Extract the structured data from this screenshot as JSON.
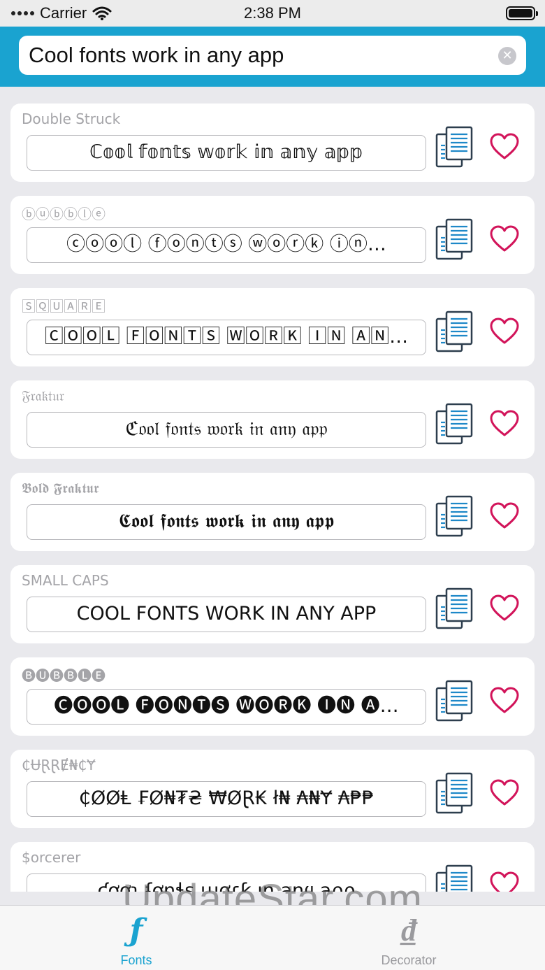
{
  "status_bar": {
    "carrier": "Carrier",
    "time": "2:38 PM"
  },
  "search": {
    "value": "Cool fonts work in any app",
    "clear_icon": "clear-circle-icon"
  },
  "cards": [
    {
      "label": "Double Struck",
      "value": "ℂ𝕠𝕠𝕝 𝕗𝕠𝕟𝕥𝕤 𝕨𝕠𝕣𝕜 𝕚𝕟 𝕒𝕟𝕪 𝕒𝕡𝕡"
    },
    {
      "label": "ⓑⓤⓑⓑⓛⓔ",
      "value": "ⓒⓞⓞⓛ ⓕⓞⓝⓣⓢ ⓦⓞⓡⓚ ⓘⓝ…"
    },
    {
      "label": "🅂🅀🅄🄰🅁🄴",
      "value": "🄲🄾🄾🄻 🄵🄾🄽🅃🅂 🅆🄾🅁🄺 🄸🄽 🄰🄽…"
    },
    {
      "label": "𝔉𝔯𝔞𝔨𝔱𝔲𝔯",
      "value": "ℭ𝔬𝔬𝔩 𝔣𝔬𝔫𝔱𝔰 𝔴𝔬𝔯𝔨 𝔦𝔫 𝔞𝔫𝔶 𝔞𝔭𝔭"
    },
    {
      "label": "𝕭𝖔𝖑𝖉 𝕱𝖗𝖆𝖐𝖙𝖚𝖗",
      "value": "𝕮𝖔𝖔𝖑 𝖋𝖔𝖓𝖙𝖘 𝖜𝖔𝖗𝖐 𝖎𝖓 𝖆𝖓𝖞 𝖆𝖕𝖕"
    },
    {
      "label": "SMALL CAPS",
      "value": "COOL FONTS WORK IN ANY APP"
    },
    {
      "label": "🅑🅤🅑🅑🅛🅔",
      "value": "🅒🅞🅞🅛 🅕🅞🅝🅣🅢 🅦🅞🅡🅚 🅘🅝 🅐…"
    },
    {
      "label": "₵ɄⱤⱤɆ₦₵Ɏ",
      "value": "₵ØØⱠ ₣Ø₦₮₴ ₩ØⱤ₭ ł₦ ₳₦Ɏ ₳₱₱"
    },
    {
      "label": "$orcerer",
      "value": "ƈơơʅ ʄơŋɬʂ ɯơɾƙ ıŋ ąŋყ ąρρ"
    }
  ],
  "tabs": [
    {
      "label": "Fonts",
      "icon": "ƒ",
      "active": true
    },
    {
      "label": "Decorator",
      "icon": "₫",
      "active": false
    }
  ],
  "watermark": "UpdateStar.com",
  "colors": {
    "header": "#1aa3d0",
    "heart": "#d2145a",
    "copy_icon": "#1e88c8"
  }
}
